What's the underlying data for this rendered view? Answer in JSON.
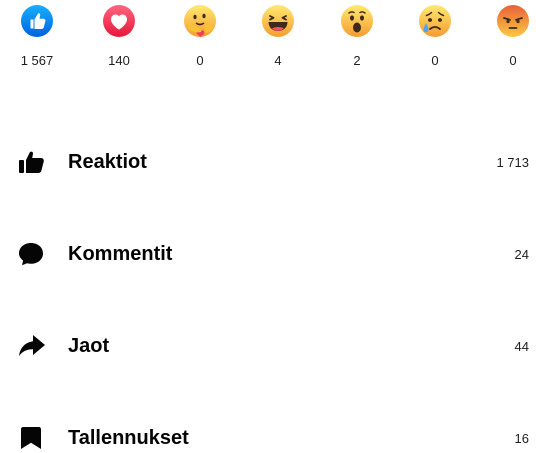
{
  "reactions": [
    {
      "name": "like",
      "icon": "like-reaction-icon",
      "count": "1 567",
      "color": "#1877f2"
    },
    {
      "name": "love",
      "icon": "love-reaction-icon",
      "count": "140",
      "color": "#f33e58"
    },
    {
      "name": "care",
      "icon": "care-reaction-icon",
      "count": "0",
      "color": "#f7b125"
    },
    {
      "name": "haha",
      "icon": "haha-reaction-icon",
      "count": "4",
      "color": "#f7b125"
    },
    {
      "name": "wow",
      "icon": "wow-reaction-icon",
      "count": "2",
      "color": "#f7b125"
    },
    {
      "name": "sad",
      "icon": "sad-reaction-icon",
      "count": "0",
      "color": "#f7b125"
    },
    {
      "name": "angry",
      "icon": "angry-reaction-icon",
      "count": "0",
      "color": "#e9710f"
    }
  ],
  "metrics": [
    {
      "icon": "thumbs-up-icon",
      "label": "Reaktiot",
      "value": "1 713"
    },
    {
      "icon": "comment-bubble-icon",
      "label": "Kommentit",
      "value": "24"
    },
    {
      "icon": "share-arrow-icon",
      "label": "Jaot",
      "value": "44"
    },
    {
      "icon": "bookmark-icon",
      "label": "Tallennukset",
      "value": "16"
    }
  ]
}
